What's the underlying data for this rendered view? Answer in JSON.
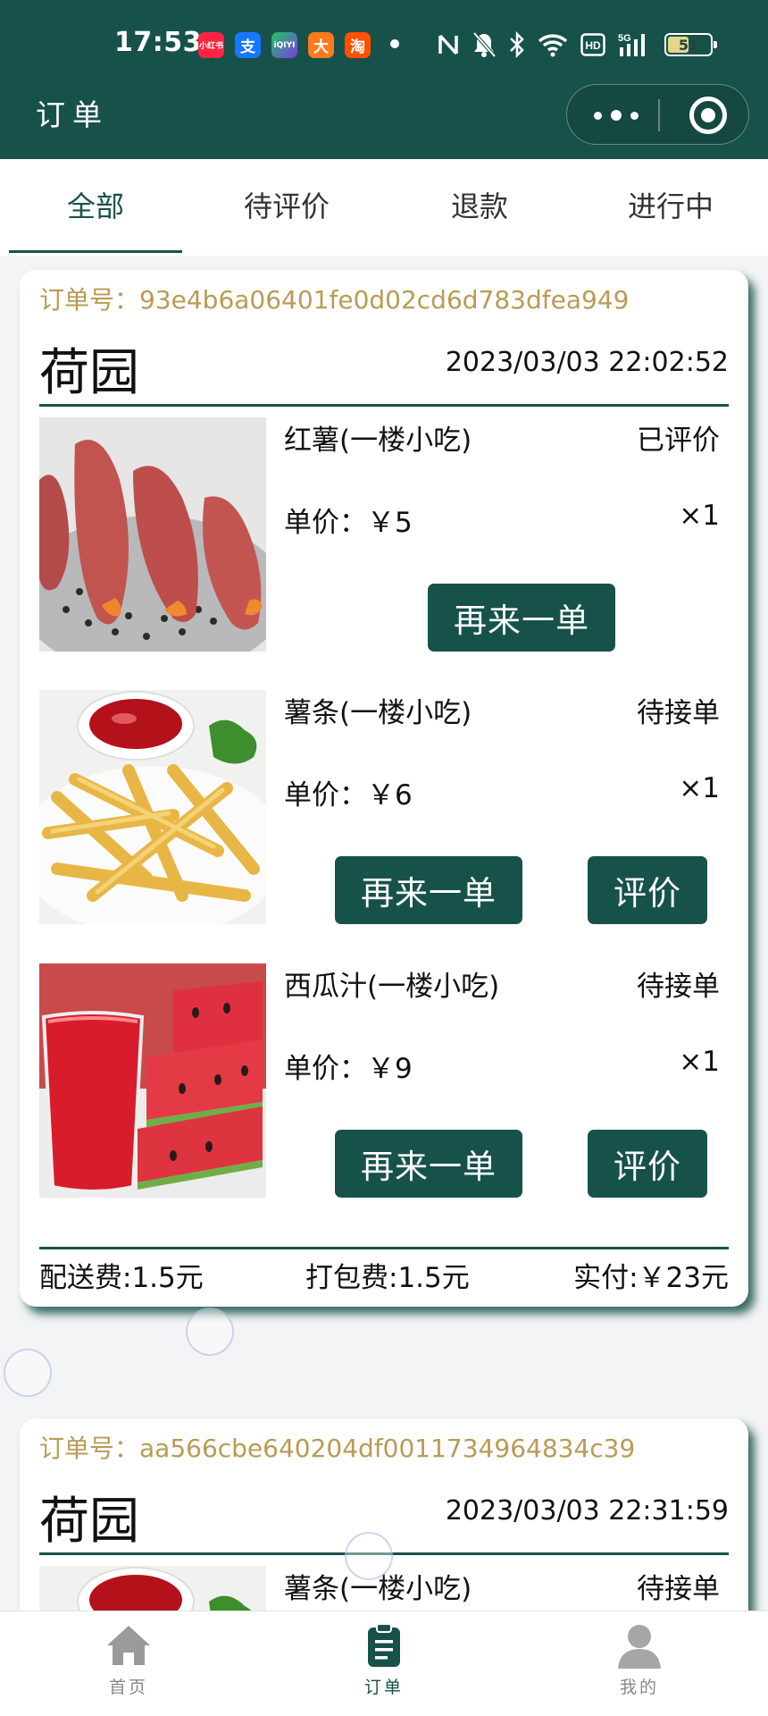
{
  "status_bar": {
    "time": "17:53",
    "app_icons": [
      {
        "name": "xiaohongshu-icon",
        "text": "小红书",
        "color": "#ff2442"
      },
      {
        "name": "alipay-icon",
        "text": "支",
        "color": "#1677ff"
      },
      {
        "name": "iqiyi-icon",
        "text": "iQIYI",
        "color": "#7c3aed"
      },
      {
        "name": "meituan-icon",
        "text": "大",
        "color": "#ff7a1a"
      },
      {
        "name": "taobao-icon",
        "text": "淘",
        "color": "#ff5000"
      }
    ],
    "battery": "51"
  },
  "nav": {
    "title": "订单"
  },
  "tabs": [
    {
      "label": "全部",
      "active": true
    },
    {
      "label": "待评价",
      "active": false
    },
    {
      "label": "退款",
      "active": false
    },
    {
      "label": "进行中",
      "active": false
    }
  ],
  "orders": [
    {
      "order_no": "订单号：93e4b6a06401fe0d02cd6d783dfea949",
      "store": "荷园",
      "time": "2023/03/03 22:02:52",
      "items": [
        {
          "name": "红薯(一楼小吃)",
          "status": "已评价",
          "price": "单价：￥5",
          "qty": "×1",
          "reorder": "再来一单",
          "review": null,
          "image": "sweet-potato"
        },
        {
          "name": "薯条(一楼小吃)",
          "status": "待接单",
          "price": "单价：￥6",
          "qty": "×1",
          "reorder": "再来一单",
          "review": "评价",
          "image": "fries"
        },
        {
          "name": "西瓜汁(一楼小吃)",
          "status": "待接单",
          "price": "单价：￥9",
          "qty": "×1",
          "reorder": "再来一单",
          "review": "评价",
          "image": "watermelon-juice"
        }
      ],
      "delivery_fee": "配送费:1.5元",
      "packing_fee": "打包费:1.5元",
      "paid": "实付:￥23元"
    },
    {
      "order_no": "订单号：aa566cbe640204df0011734964834c39",
      "store": "荷园",
      "time": "2023/03/03 22:31:59",
      "items": [
        {
          "name": "薯条(一楼小吃)",
          "status": "待接单",
          "image": "fries"
        }
      ]
    }
  ],
  "tabbar": [
    {
      "label": "首页",
      "icon": "home-icon",
      "active": false
    },
    {
      "label": "订单",
      "icon": "order-clipboard-icon",
      "active": true
    },
    {
      "label": "我的",
      "icon": "user-icon",
      "active": false
    }
  ],
  "colors": {
    "primary": "#17524a",
    "order_no": "#b99b55"
  }
}
